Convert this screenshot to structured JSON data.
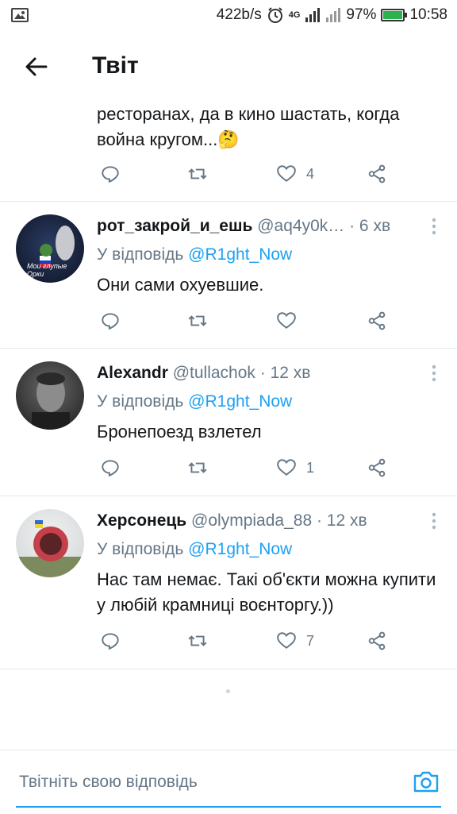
{
  "status_bar": {
    "speed": "422b/s",
    "network": "4G",
    "battery": "97%",
    "battery_fraction": 0.97,
    "time": "10:58"
  },
  "header": {
    "title": "Твіт"
  },
  "cut_tweet": {
    "text": "ресторанах, да в кино шастать, когда война кругом...🤔",
    "like_count": "4"
  },
  "tweets": [
    {
      "name": "рот_закрой_и_ешь",
      "handle": "@aq4y0k…",
      "time": "· 6 хв",
      "reply_prefix": "У відповідь",
      "reply_to": "@R1ght_Now",
      "text": "Они сами охуевшие.",
      "like_count": "",
      "avatar_text": "Мои глупые Орки"
    },
    {
      "name": "Alexandr",
      "handle": "@tullachok",
      "time": "· 12 хв",
      "reply_prefix": "У відповідь",
      "reply_to": "@R1ght_Now",
      "text": "Бронепоезд взлетел",
      "like_count": "1"
    },
    {
      "name": "Херсонець",
      "handle": "@olympiada_88",
      "time": "· 12 хв",
      "reply_prefix": "У відповідь",
      "reply_to": "@R1ght_Now",
      "text": "Нас там немає. Такі об'єкти  можна купити у любій крамниці воєнторгу.))",
      "like_count": "7"
    }
  ],
  "composer": {
    "placeholder": "Твітніть свою відповідь"
  },
  "colors": {
    "accent": "#1da1f2",
    "muted": "#657786",
    "divider": "#e1e8ed"
  }
}
